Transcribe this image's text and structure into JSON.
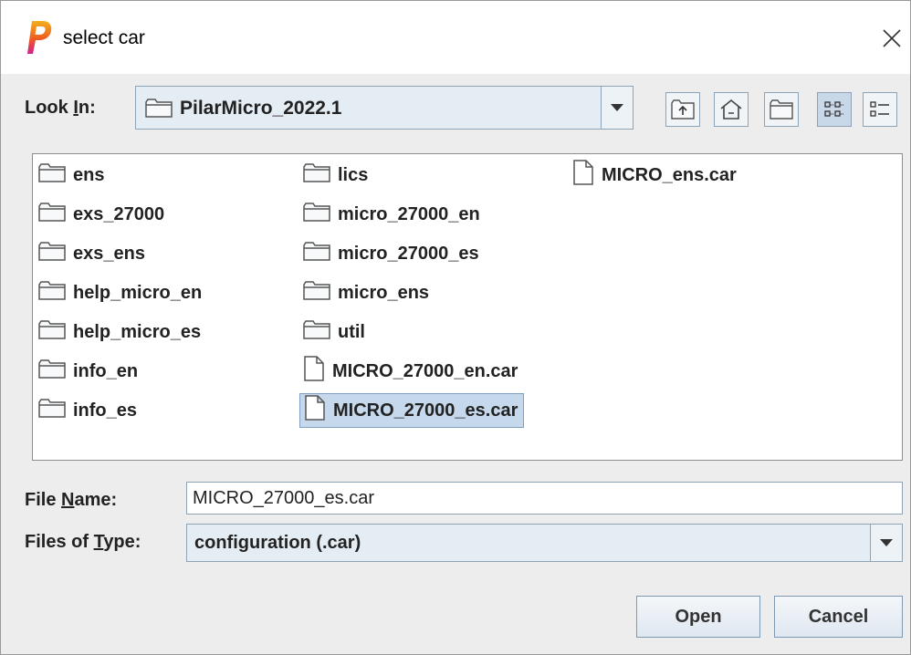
{
  "window": {
    "title": "select car",
    "app_icon": "pilar-p-icon"
  },
  "look_in": {
    "label_prefix": "Look ",
    "label_mnemonic": "I",
    "label_suffix": "n:",
    "value": "PilarMicro_2022.1"
  },
  "toolbar": {
    "buttons": [
      {
        "name": "up-one-level-icon"
      },
      {
        "name": "home-icon"
      },
      {
        "name": "new-folder-icon"
      },
      {
        "name": "list-view-icon",
        "selected": true
      },
      {
        "name": "details-view-icon"
      }
    ]
  },
  "files": {
    "column1": [
      "ens",
      "exs_27000",
      "exs_ens",
      "help_micro_en",
      "help_micro_es",
      "info_en",
      "info_es"
    ],
    "column2_folders": [
      "lics",
      "micro_27000_en",
      "micro_27000_es",
      "micro_ens",
      "util"
    ],
    "column2_files": [
      "MICRO_27000_en.car",
      "MICRO_27000_es.car"
    ],
    "column3_files": [
      "MICRO_ens.car"
    ],
    "selected": "MICRO_27000_es.car"
  },
  "file_name": {
    "label_prefix": "File ",
    "label_mnemonic": "N",
    "label_suffix": "ame:",
    "value": "MICRO_27000_es.car"
  },
  "file_type": {
    "label_prefix": "Files of ",
    "label_mnemonic": "T",
    "label_suffix": "ype:",
    "value": "configuration (.car)"
  },
  "buttons": {
    "open": "Open",
    "cancel": "Cancel"
  }
}
